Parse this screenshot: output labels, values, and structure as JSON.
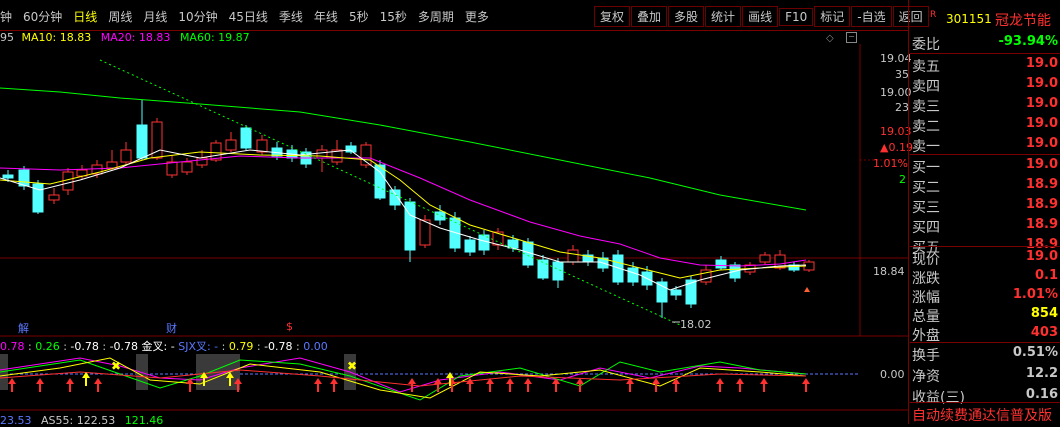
{
  "toolbar": {
    "tabs": [
      {
        "label": "钟",
        "active": false
      },
      {
        "label": "60分钟",
        "active": false
      },
      {
        "label": "日线",
        "active": true
      },
      {
        "label": "周线",
        "active": false
      },
      {
        "label": "月线",
        "active": false
      },
      {
        "label": "10分钟",
        "active": false
      },
      {
        "label": "45日线",
        "active": false
      },
      {
        "label": "季线",
        "active": false
      },
      {
        "label": "年线",
        "active": false
      },
      {
        "label": "5秒",
        "active": false
      },
      {
        "label": "15秒",
        "active": false
      },
      {
        "label": "多周期",
        "active": false
      },
      {
        "label": "更多",
        "active": false
      }
    ],
    "buttons": [
      "复权",
      "叠加",
      "多股",
      "统计",
      "画线",
      "F10",
      "标记",
      "-自选",
      "返回"
    ]
  },
  "stock": {
    "tag": "R",
    "code": "301151",
    "name": "冠龙节能"
  },
  "ma": {
    "prefix": "95",
    "ma10": "MA10: 18.83",
    "ma20": "MA20: 18.83",
    "ma60": "MA60: 19.87"
  },
  "price_axis": {
    "p1": "19.04",
    "n1": "35",
    "p2": "19.00",
    "n2": "23",
    "p3": "19.03",
    "chg": "▲0.19",
    "pct": "1.01%",
    "n3": "2",
    "cur": "18.84"
  },
  "cursor_label": "18.02",
  "markers": {
    "jie": "解",
    "cai": "财",
    "s": "$"
  },
  "indicator": {
    "v1": "0.78",
    "v2": "0.26",
    "v3": "-0.78",
    "v4": "-0.78",
    "jincha": "金叉: -",
    "sjx": "SJX叉: -",
    "v5": "0.79",
    "v6": "-0.78",
    "v7": "0.00",
    "zero": "0.00"
  },
  "bottom": {
    "a": "23.53",
    "b": "AS55: 122.53",
    "c": "121.46"
  },
  "right_panel": {
    "weibi_label": "委比",
    "weibi_val": "-93.94%",
    "sells": [
      {
        "l": "卖五",
        "v": "19.0"
      },
      {
        "l": "卖四",
        "v": "19.0"
      },
      {
        "l": "卖三",
        "v": "19.0"
      },
      {
        "l": "卖二",
        "v": "19.0"
      },
      {
        "l": "卖一",
        "v": "19.0"
      }
    ],
    "buys": [
      {
        "l": "买一",
        "v": "19.0"
      },
      {
        "l": "买二",
        "v": "18.9"
      },
      {
        "l": "买三",
        "v": "18.9"
      },
      {
        "l": "买四",
        "v": "18.9"
      },
      {
        "l": "买五",
        "v": "18.9"
      }
    ],
    "stats": [
      {
        "l": "现价",
        "v": "19.0",
        "c": "#ff3030"
      },
      {
        "l": "涨跌",
        "v": "0.1",
        "c": "#ff3030"
      },
      {
        "l": "涨幅",
        "v": "1.01%",
        "c": "#ff3030"
      },
      {
        "l": "总量",
        "v": "854",
        "c": "#ffff00"
      },
      {
        "l": "外盘",
        "v": "403",
        "c": "#ff3030"
      }
    ],
    "stats2": [
      {
        "l": "换手",
        "v": "0.51%",
        "c": "#c8c8c8"
      },
      {
        "l": "净资",
        "v": "12.2",
        "c": "#c8c8c8"
      },
      {
        "l": "收益(三)",
        "v": "0.16",
        "c": "#c8c8c8"
      }
    ],
    "ticker": "自动续费通达信普及版"
  },
  "colors": {
    "up": "#ff3232",
    "down": "#54ffff",
    "ma5": "#ffffff",
    "ma10": "#ffff00",
    "ma20": "#ff00ff",
    "ma60": "#00ff00",
    "bg": "#000000",
    "grid": "#7a0000"
  }
}
